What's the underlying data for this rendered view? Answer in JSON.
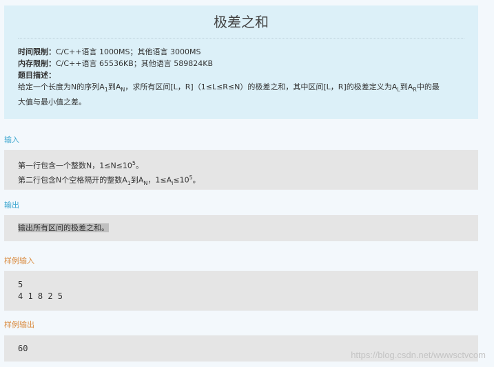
{
  "problem": {
    "title": "极差之和",
    "time_limit_label": "时间限制：",
    "time_limit_value": "C/C++语言 1000MS；其他语言 3000MS",
    "memory_limit_label": "内存限制：",
    "memory_limit_value": "C/C++语言 65536KB；其他语言 589824KB",
    "desc_label": "题目描述：",
    "desc_text_1": "给定一个长度为N的序列A",
    "desc_text_1_sub1": "1",
    "desc_text_2": "到A",
    "desc_text_2_sub": "N",
    "desc_text_3": "，求所有区间[L，R]（1≤L≤R≤N）的极差之和，其中区间[L，R]的极差定义为A",
    "desc_text_3_sub": "L",
    "desc_text_4": "到A",
    "desc_text_4_sub": "R",
    "desc_text_5": "中的最",
    "desc_text_6": "大值与最小值之差。"
  },
  "input": {
    "label": "输入",
    "line1_a": "第一行包含一个整数N，1≤N≤10",
    "line1_sup": "5",
    "line1_b": "。",
    "line2_a": "第二行包含N个空格隔开的整数A",
    "line2_sub1": "1",
    "line2_b": "到A",
    "line2_sub2": "N",
    "line2_c": "，1≤A",
    "line2_sub3": "i",
    "line2_d": "≤10",
    "line2_sup": "5",
    "line2_e": "。"
  },
  "output": {
    "label": "输出",
    "text": "输出所有区间的极差之和。"
  },
  "sample_input": {
    "label": "样例输入",
    "line1": "5",
    "line2": "4 1 8 2 5"
  },
  "sample_output": {
    "label": "样例输出",
    "value": "60"
  },
  "watermark": "https://blog.csdn.net/wwwsctvcom"
}
